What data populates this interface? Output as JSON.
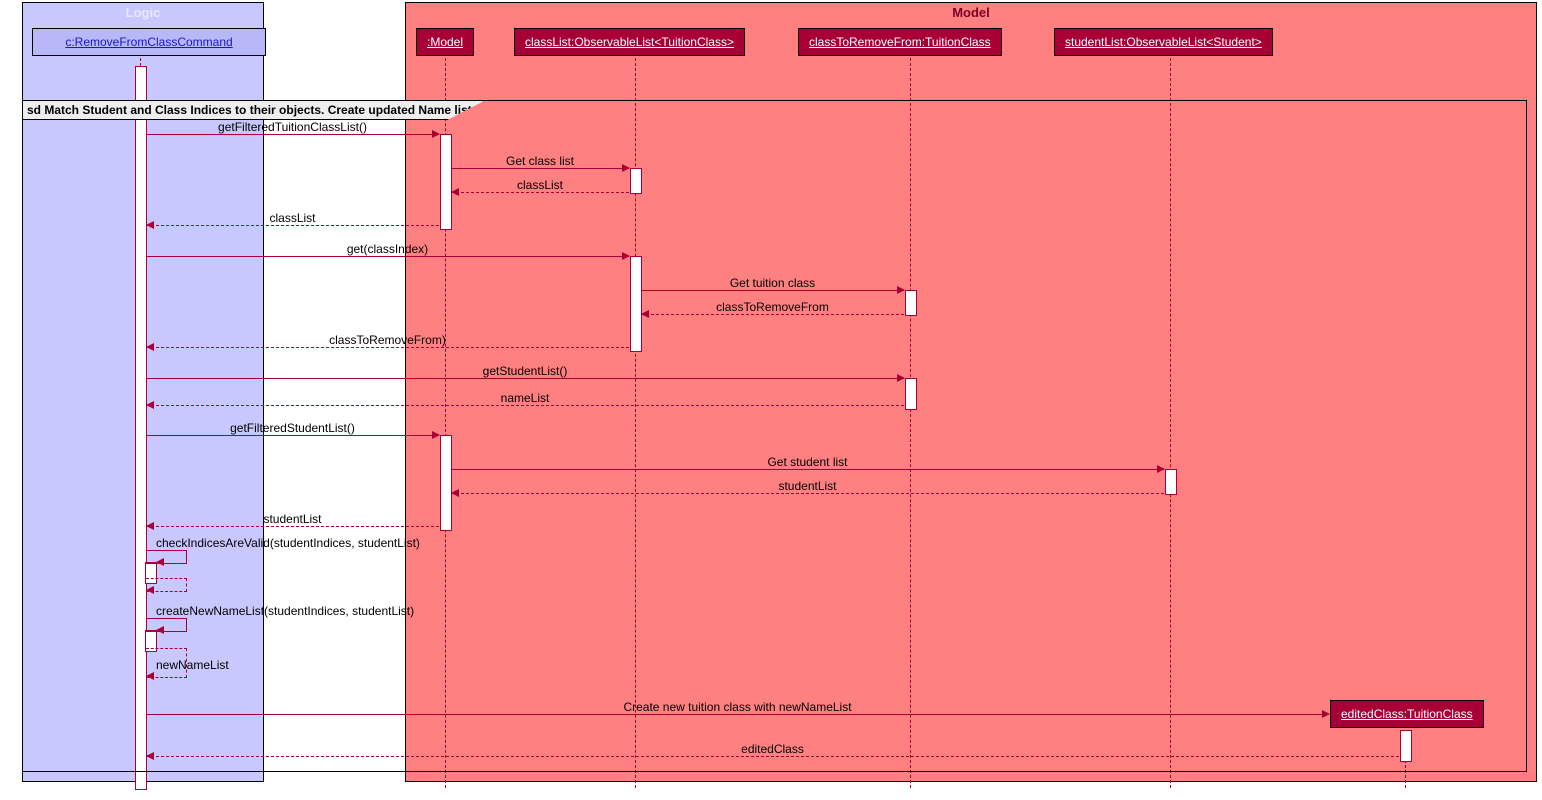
{
  "packages": {
    "logic": {
      "title": "Logic"
    },
    "model": {
      "title": "Model"
    }
  },
  "participants": {
    "c": "c:RemoveFromClassCommand",
    "model": ":Model",
    "classList": "classList:ObservableList<TuitionClass>",
    "classToRemoveFrom": "classToRemoveFrom:TuitionClass",
    "studentList": "studentList:ObservableList<Student>",
    "editedClass": "editedClass:TuitionClass"
  },
  "frame": {
    "label": "sd Match Student and Class Indices to their objects. Create updated Name list."
  },
  "messages": {
    "m1": "getFilteredTuitionClassList()",
    "m2": "Get class list",
    "m3": "classList",
    "m4": "classList",
    "m5": "get(classIndex)",
    "m6": "Get tuition class",
    "m7": "classToRemoveFrom",
    "m8": "classToRemoveFrom)",
    "m9": "getStudentList()",
    "m10": "nameList",
    "m11": "getFilteredStudentList()",
    "m12": "Get student list",
    "m13": "studentList",
    "m14": "studentList",
    "m15": "checkIndicesAreValid(studentIndices, studentList)",
    "m16": "createNewNameList(studentIndices, studentList)",
    "m17": "newNameList",
    "m18": "Create new tuition class with newNameList",
    "m19": "editedClass"
  }
}
